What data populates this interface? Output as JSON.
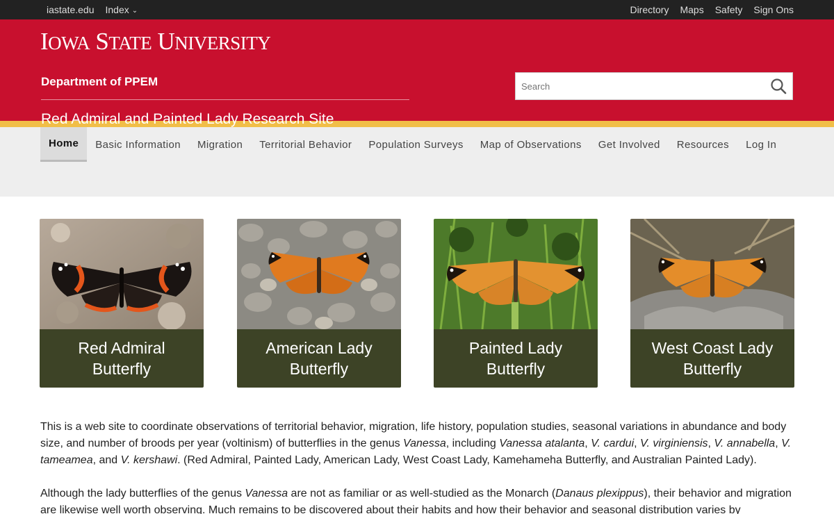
{
  "topbar": {
    "left": [
      "iastate.edu",
      "Index"
    ],
    "right": [
      "Directory",
      "Maps",
      "Safety",
      "Sign Ons"
    ]
  },
  "header": {
    "wordmark": "Iowa State University",
    "department": "Department of PPEM",
    "site_name": "Red Admiral and Painted Lady Research Site",
    "search_placeholder": "Search"
  },
  "nav": {
    "items": [
      "Home",
      "Basic Information",
      "Migration",
      "Territorial Behavior",
      "Population Surveys",
      "Map of Observations",
      "Get Involved",
      "Resources",
      "Log In"
    ],
    "active": "Home"
  },
  "cards": [
    {
      "line1": "Red Admiral",
      "line2": "Butterfly"
    },
    {
      "line1": "American Lady",
      "line2": "Butterfly"
    },
    {
      "line1": "Painted Lady",
      "line2": "Butterfly"
    },
    {
      "line1": "West Coast Lady",
      "line2": "Butterfly"
    }
  ],
  "content": {
    "p1": [
      "This is a web site to coordinate observations of territorial behavior, migration, life history, population studies, seasonal variations in abundance and body size, and number of broods per year (voltinism) of butterflies in the genus ",
      "Vanessa",
      ", including ",
      "Vanessa atalanta",
      ", ",
      "V. cardui",
      ", ",
      "V. virginiensis",
      ", ",
      "V. annabella",
      ", ",
      "V. tameamea",
      ", and ",
      "V. kershawi",
      ". (Red Admiral, Painted Lady, American Lady, West Coast Lady, Kamehameha Butterfly, and Australian Painted Lady)."
    ],
    "p2": [
      "Although the lady butterflies of the genus ",
      "Vanessa",
      " are not as familiar or as well-studied as the Monarch (",
      "Danaus plexippus",
      "), their behavior and migration are likewise well worth observing. Much remains to be discovered about their habits and how their behavior and seasonal distribution varies by"
    ]
  },
  "colors": {
    "cardinal": "#c8102e",
    "gold": "#f1be48",
    "card_caption": "#3d4326"
  }
}
